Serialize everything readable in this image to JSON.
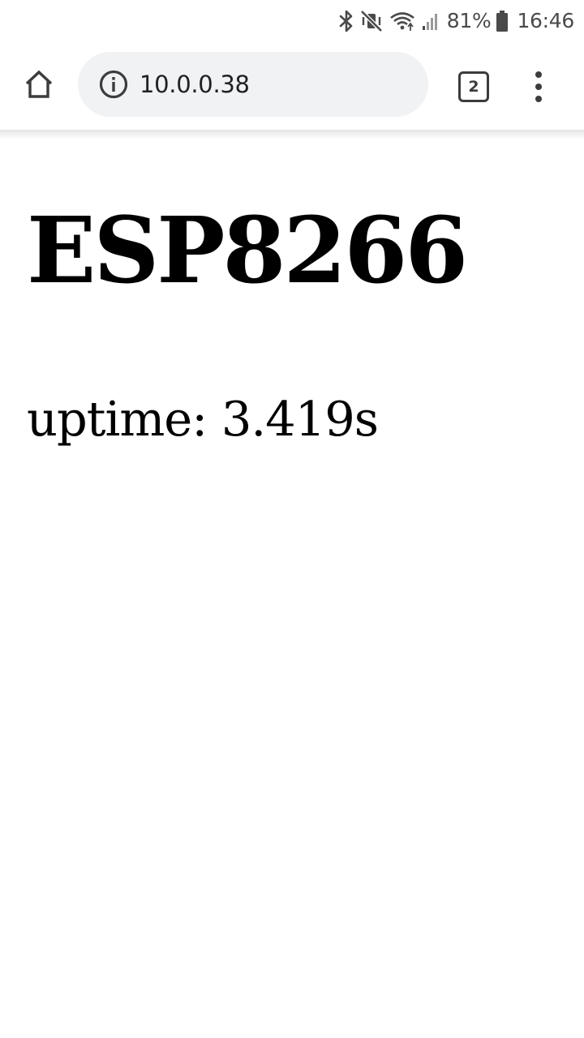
{
  "status_bar": {
    "battery_percent": "81%",
    "time": "16:46",
    "icons": [
      "bluetooth-icon",
      "vibrate-mute-icon",
      "wifi-icon",
      "cell-signal-icon",
      "battery-icon"
    ]
  },
  "toolbar": {
    "url": "10.0.0.38",
    "tab_count": "2",
    "icons": [
      "home-icon",
      "info-icon",
      "tab-switcher-icon",
      "more-vert-icon"
    ]
  },
  "page": {
    "heading": "ESP8266",
    "uptime_label": "uptime:",
    "uptime_value": "3.419s"
  }
}
